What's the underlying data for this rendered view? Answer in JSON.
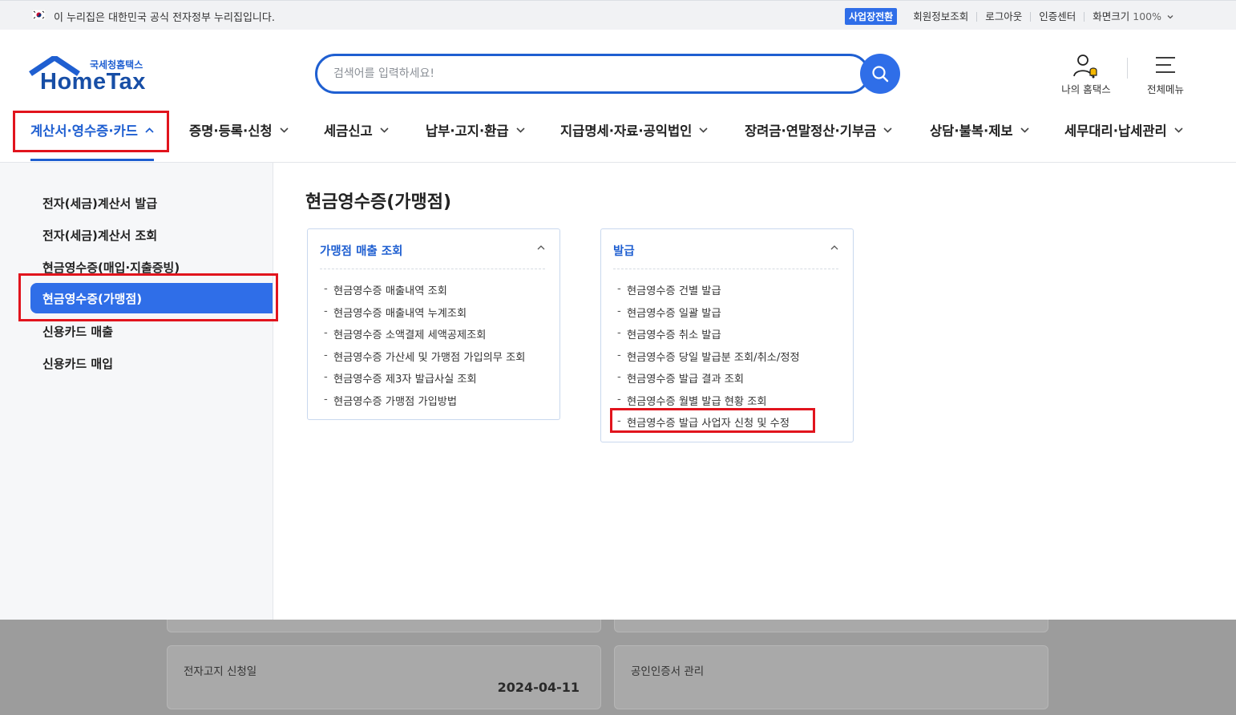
{
  "gov_banner": {
    "text": "이 누리집은 대한민국 공식 전자정부 누리집입니다.",
    "flag_icon": "korea-flag-icon"
  },
  "utility": {
    "switch_badge": "사업장전환",
    "links": [
      "회원정보조회",
      "로그아웃",
      "인증센터"
    ],
    "zoom_label": "화면크기",
    "zoom_value": "100%"
  },
  "logo": {
    "sub": "국세청홈택스",
    "main": "HomeTax"
  },
  "search": {
    "placeholder": "검색어를 입력하세요!",
    "value": ""
  },
  "header_actions": {
    "my_hometax": "나의 홈택스",
    "all_menu": "전체메뉴"
  },
  "gnb": [
    {
      "label": "계산서·영수증·카드",
      "active": true
    },
    {
      "label": "증명·등록·신청"
    },
    {
      "label": "세금신고"
    },
    {
      "label": "납부·고지·환급"
    },
    {
      "label": "지급명세·자료·공익법인"
    },
    {
      "label": "장려금·연말정산·기부금"
    },
    {
      "label": "상담·불복·제보"
    },
    {
      "label": "세무대리·납세관리"
    }
  ],
  "sidebar": {
    "items": [
      {
        "label": "전자(세금)계산서 발급"
      },
      {
        "label": "전자(세금)계산서 조회"
      },
      {
        "label": "현금영수증(매입·지출증빙)"
      },
      {
        "label": "현금영수증(가맹점)",
        "active": true
      },
      {
        "label": "신용카드 매출"
      },
      {
        "label": "신용카드 매입"
      }
    ]
  },
  "main": {
    "title": "현금영수증(가맹점)",
    "cards": [
      {
        "title": "가맹점 매출 조회",
        "items": [
          "현금영수증 매출내역 조회",
          "현금영수증 매출내역 누계조회",
          "현금영수증 소액결제 세액공제조회",
          "현금영수증 가산세 및 가맹점 가입의무 조회",
          "현금영수증 제3자 발급사실 조회",
          "현금영수증 가맹점 가입방법"
        ]
      },
      {
        "title": "발급",
        "items": [
          "현금영수증 건별 발급",
          "현금영수증 일괄 발급",
          "현금영수증 취소 발급",
          "현금영수증 당일 발급분 조회/취소/정정",
          "현금영수증 발급 결과 조회",
          "현금영수증 월별 발급 현황 조회",
          "현금영수증 발급 사업자 신청 및 수정"
        ]
      }
    ]
  },
  "background": {
    "cards": [
      {
        "label": "전자고지 신청일",
        "value": "2024-04-11"
      },
      {
        "label": "공인인증서 관리",
        "value": ""
      }
    ]
  },
  "colors": {
    "brand_blue": "#2f6ee8",
    "link_blue": "#1f5fd1",
    "highlight_red": "#e1141d"
  }
}
